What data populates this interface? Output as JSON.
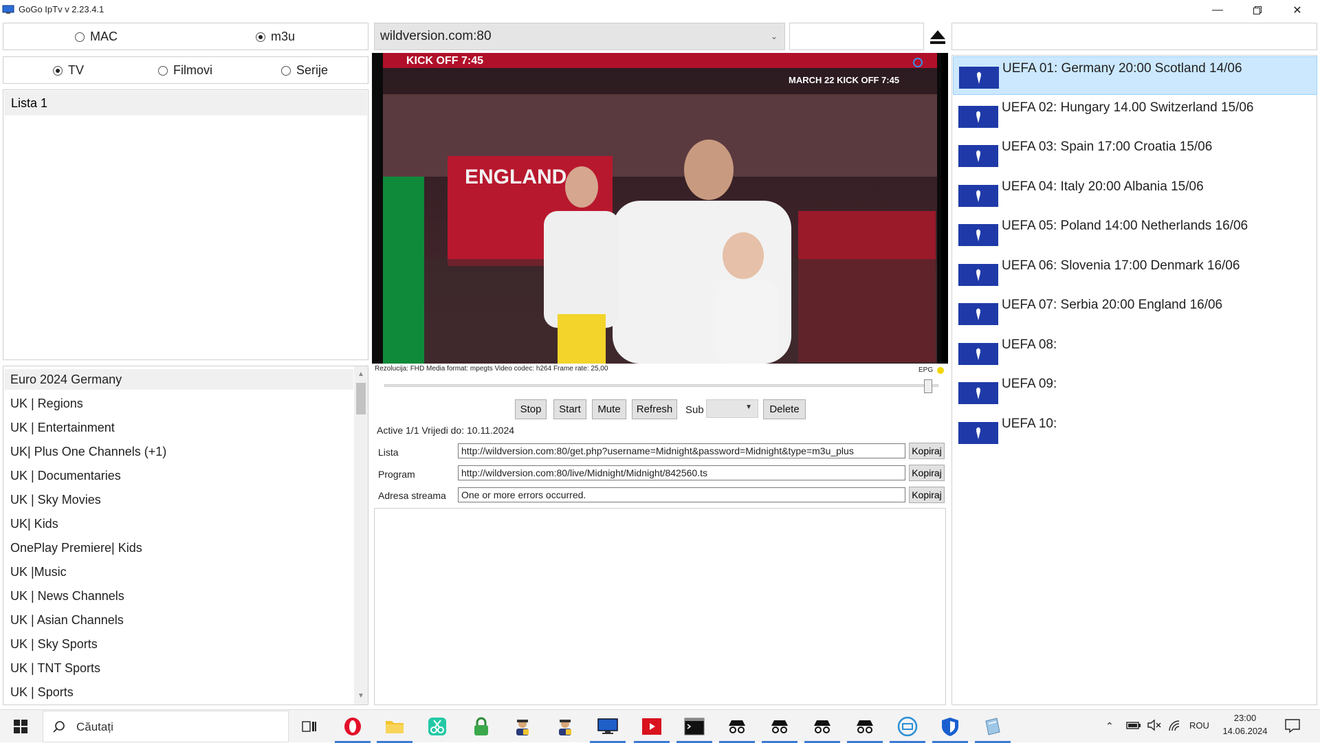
{
  "window": {
    "title": "GoGo IpTv v 2.23.4.1"
  },
  "source_mode": {
    "options": [
      "MAC",
      "m3u"
    ],
    "selected": "m3u"
  },
  "content_type": {
    "options": [
      "TV",
      "Filmovi",
      "Serije"
    ],
    "selected": "TV"
  },
  "server_dropdown": {
    "value": "wildversion.com:80"
  },
  "lists_panel": {
    "items": [
      "Lista 1"
    ]
  },
  "categories": {
    "items": [
      "Euro 2024 Germany",
      "UK | Regions",
      "UK | Entertainment",
      "UK| Plus One Channels (+1)",
      "UK | Documentaries",
      "UK | Sky Movies",
      "UK| Kids",
      "OnePlay Premiere| Kids",
      "UK |Music",
      "UK | News Channels",
      "UK | Asian Channels",
      "UK | Sky Sports",
      "UK | TNT Sports",
      "UK | Sports"
    ],
    "selected_index": 0
  },
  "video": {
    "overlay_text_left": "KICK OFF 7:45",
    "overlay_text_right": "MARCH 22  KICK OFF 7:45",
    "banner_text": "ENGLAND"
  },
  "status": {
    "info": "Rezolucija: FHD Media format: mpegts Video codec: h264 Frame rate: 25,00",
    "epg_label": "EPG",
    "epg_indicator_color": "#f2d600",
    "seek_position": 0.99
  },
  "controls": {
    "stop": "Stop",
    "start": "Start",
    "mute": "Mute",
    "refresh": "Refresh",
    "sub_label": "Sub",
    "delete": "Delete"
  },
  "account": {
    "status_text": "Active 1/1 Vrijedi do: 10.11.2024"
  },
  "fields": {
    "lista_label": "Lista",
    "lista_value": "http://wildversion.com:80/get.php?username=Midnight&password=Midnight&type=m3u_plus",
    "program_label": "Program",
    "program_value": "http://wildversion.com:80/live/Midnight/Midnight/842560.ts",
    "stream_label": "Adresa streama",
    "stream_value": "One or more errors occurred.",
    "copy_label": "Kopiraj"
  },
  "epg": {
    "items": [
      "UEFA 01: Germany 20:00 Scotland 14/06",
      "UEFA 02: Hungary 14.00 Switzerland 15/06",
      "UEFA 03: Spain 17:00 Croatia 15/06",
      "UEFA 04: Italy 20:00 Albania 15/06",
      "UEFA 05: Poland 14:00 Netherlands 16/06",
      "UEFA 06: Slovenia 17:00 Denmark 16/06",
      "UEFA 07: Serbia 20:00 England 16/06",
      "UEFA 08:",
      "UEFA 09:",
      "UEFA 10:"
    ],
    "selected_index": 0
  },
  "taskbar": {
    "search_placeholder": "Căutați",
    "language": "ROU",
    "time": "23:00",
    "date": "14.06.2024",
    "apps": [
      "task-view",
      "opera",
      "file-explorer",
      "snipping-tool",
      "vpn-lock",
      "spy-agent-1",
      "spy-agent-2",
      "monitor",
      "media-player",
      "terminal",
      "incognito-1",
      "incognito-2",
      "incognito-3",
      "incognito-4",
      "network-app",
      "shield-app",
      "notepad"
    ]
  }
}
